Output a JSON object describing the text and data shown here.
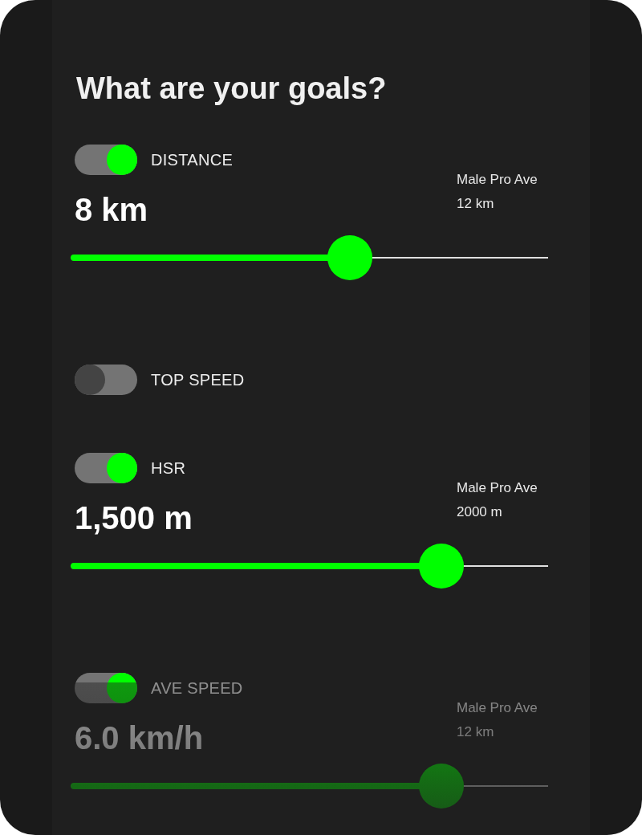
{
  "title": "What are your goals?",
  "goals": [
    {
      "label": "DISTANCE",
      "on": true,
      "value": "8 km",
      "reference_label": "Male Pro Ave",
      "reference_value": "12 km",
      "level": 0.585
    },
    {
      "label": "TOP SPEED",
      "on": false
    },
    {
      "label": "HSR",
      "on": true,
      "value": "1,500 m",
      "reference_label": "Male Pro Ave",
      "reference_value": "2000 m",
      "level": 0.777
    },
    {
      "label": "AVE SPEED",
      "on": true,
      "value": "6.0 km/h",
      "reference_label": "Male Pro Ave",
      "reference_value": "12 km",
      "level": 0.777
    }
  ]
}
